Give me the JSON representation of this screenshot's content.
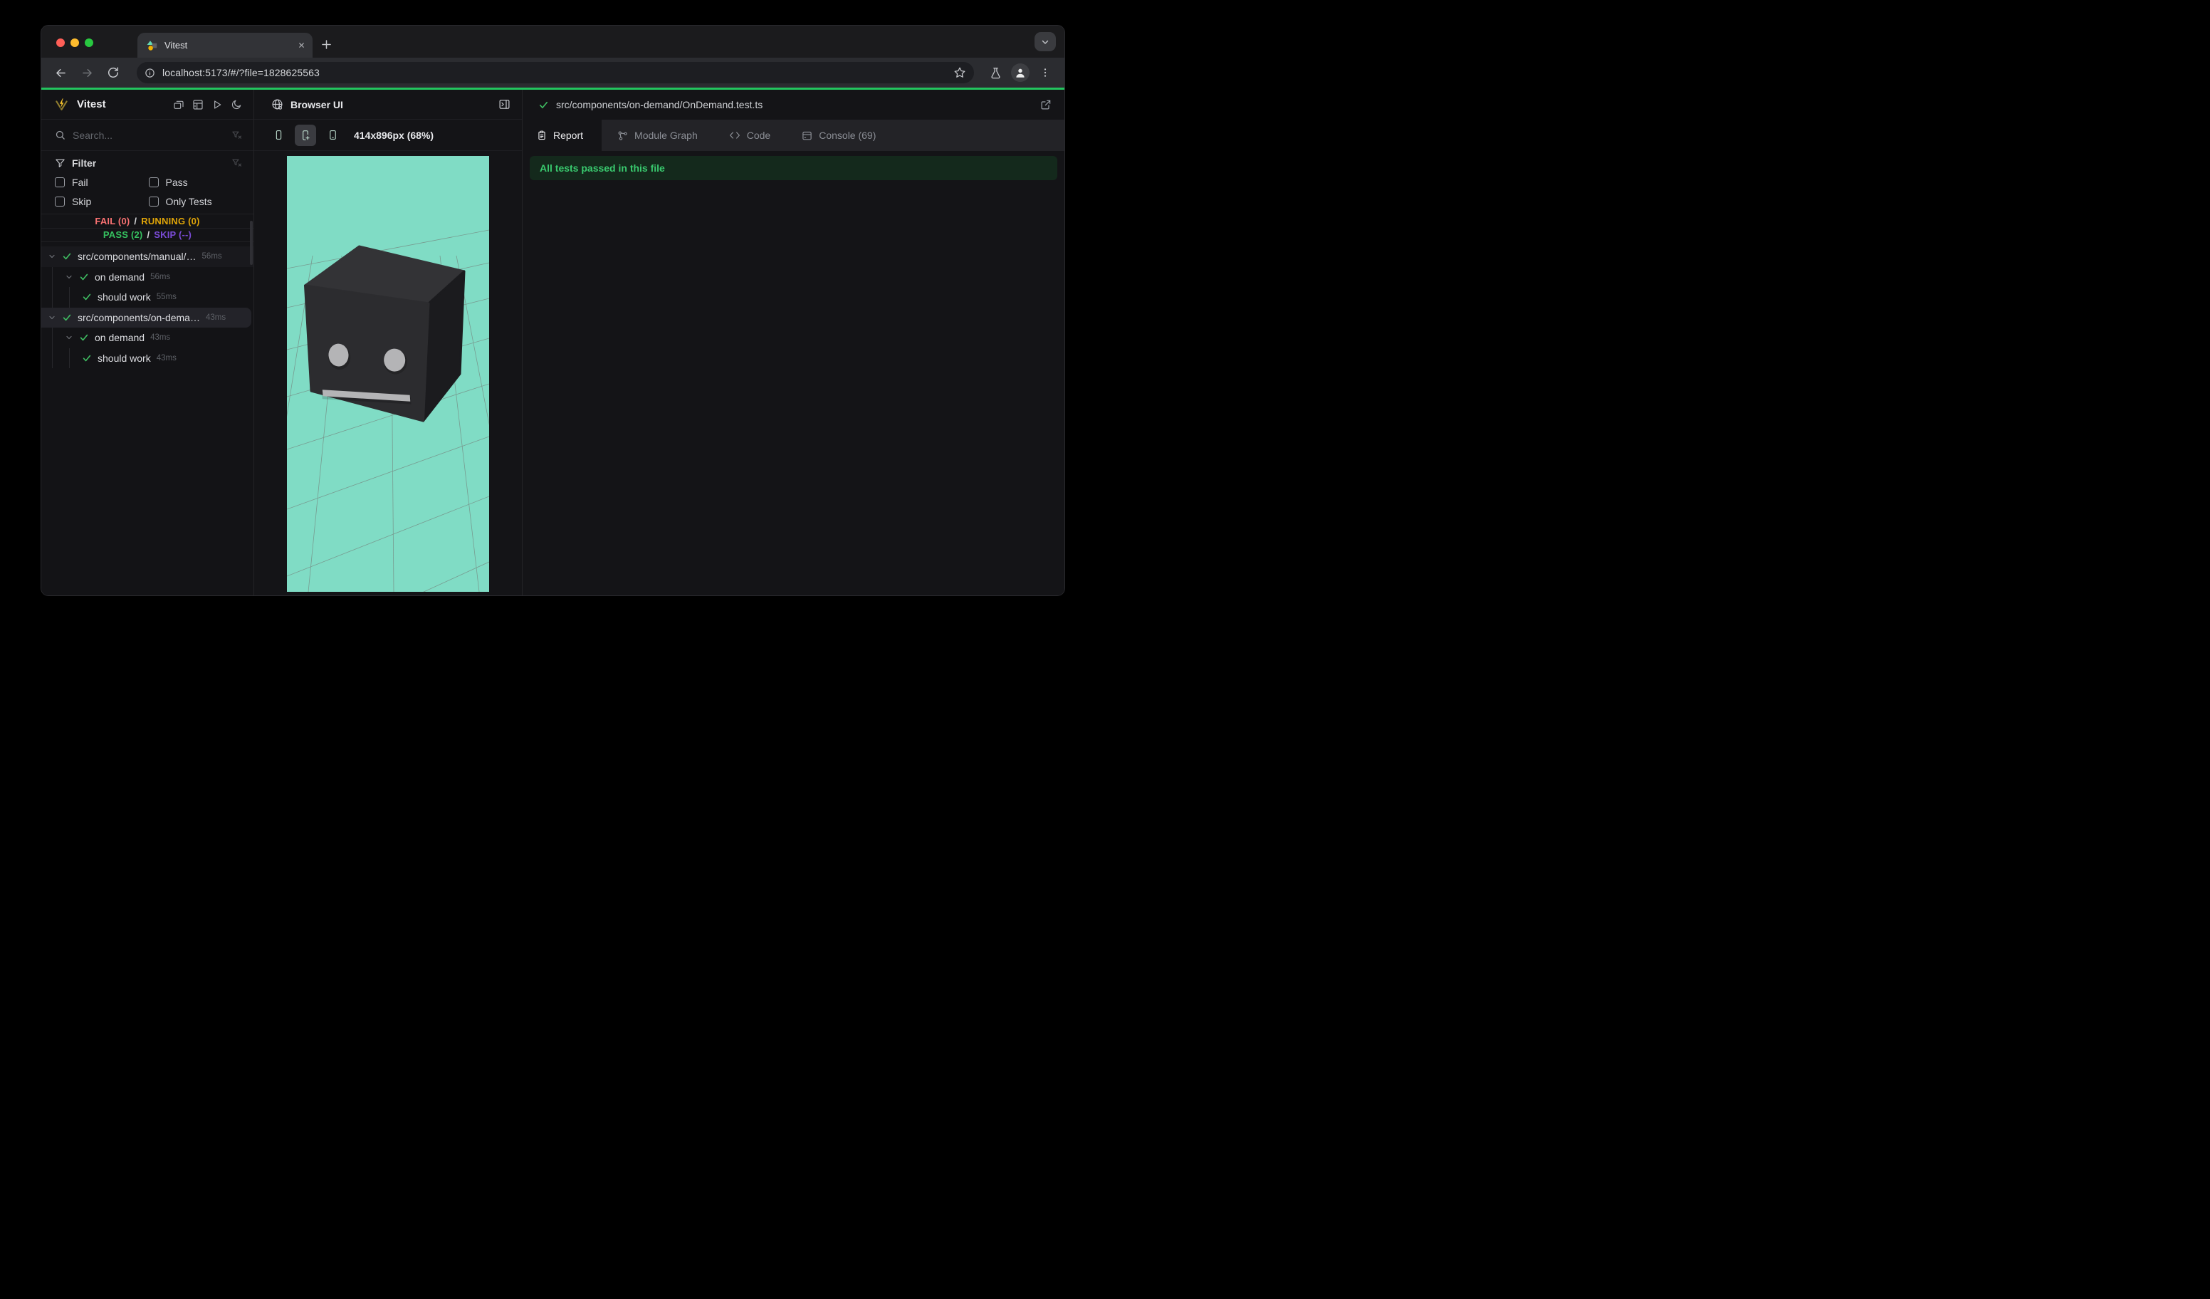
{
  "browser": {
    "tab_title": "Vitest",
    "url": "localhost:5173/#/?file=1828625563"
  },
  "sidebar": {
    "title": "Vitest",
    "search_placeholder": "Search...",
    "filter": {
      "title": "Filter",
      "options": [
        "Fail",
        "Pass",
        "Skip",
        "Only Tests"
      ]
    },
    "stats": {
      "fail": "FAIL (0)",
      "running": "RUNNING (0)",
      "pass": "PASS (2)",
      "skip": "SKIP (--)",
      "separator": "/"
    },
    "tree": [
      {
        "label": "src/components/manual/…",
        "time": "56ms",
        "level": 0
      },
      {
        "label": "on demand",
        "time": "56ms",
        "level": 1
      },
      {
        "label": "should work",
        "time": "55ms",
        "level": 2
      },
      {
        "label": "src/components/on-dema…",
        "time": "43ms",
        "level": 0
      },
      {
        "label": "on demand",
        "time": "43ms",
        "level": 1
      },
      {
        "label": "should work",
        "time": "43ms",
        "level": 2
      }
    ]
  },
  "browser_panel": {
    "title": "Browser UI",
    "viewport_label": "414x896px (68%)"
  },
  "report_panel": {
    "file_path": "src/components/on-demand/OnDemand.test.ts",
    "tabs": [
      {
        "label": "Report",
        "active": true
      },
      {
        "label": "Module Graph",
        "active": false
      },
      {
        "label": "Code",
        "active": false
      },
      {
        "label": "Console (69)",
        "active": false
      }
    ],
    "banner": "All tests passed in this file"
  },
  "icons": {
    "sidebar_actions": [
      "collapse-panels",
      "dashboard",
      "run-all",
      "dark-theme-moon"
    ],
    "device_modes": [
      "phone",
      "phone-plus-active",
      "tablet"
    ],
    "tab_icons": [
      "report-clipboard",
      "module-graph-nodes",
      "code-brackets",
      "console-window"
    ]
  },
  "colors": {
    "accent_green": "#23c55e",
    "viewport_bg": "#80dcc5",
    "fail": "#f87171",
    "running": "#dfa408",
    "pass": "#35c05f",
    "skip": "#7a4bd6",
    "banner_bg": "#14291c",
    "banner_text": "#39c96e"
  }
}
